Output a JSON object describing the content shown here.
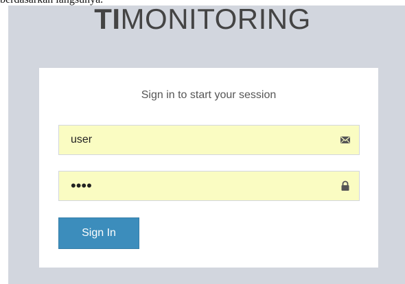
{
  "header_fragment": "berdasarkan langsunya.",
  "logo": {
    "bold": "TI",
    "regular": "MONITORING"
  },
  "login_box": {
    "message": "Sign in to start your session",
    "username": {
      "value": "user",
      "icon": "envelope-icon"
    },
    "password": {
      "value": "••••",
      "icon": "lock-icon"
    },
    "submit_label": "Sign In"
  },
  "colors": {
    "page_background": "#d2d6de",
    "input_fill": "#fafcc2",
    "button": "#3c8dbc"
  }
}
